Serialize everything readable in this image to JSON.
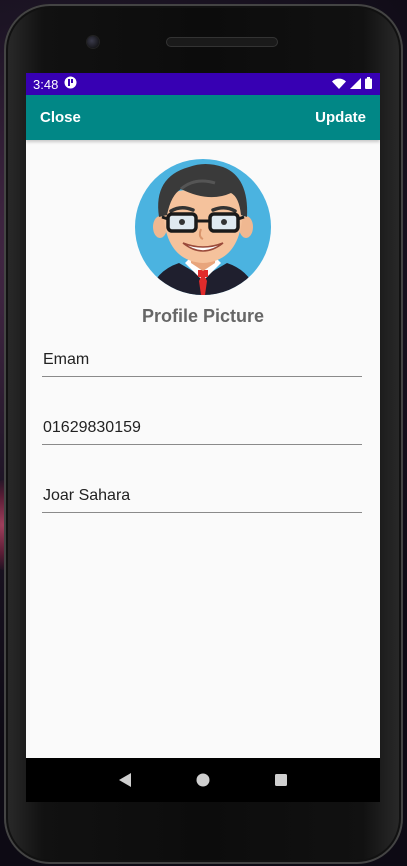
{
  "status_bar": {
    "time": "3:48"
  },
  "app_bar": {
    "close_label": "Close",
    "update_label": "Update"
  },
  "profile": {
    "picture_label": "Profile Picture"
  },
  "form": {
    "name_value": "Emam",
    "phone_value": "01629830159",
    "address_value": "Joar Sahara"
  },
  "colors": {
    "status_bar": "#3700b3",
    "app_bar": "#018786",
    "avatar_bg": "#4bb3e0"
  },
  "icons": {
    "status_app": "app-notification-icon",
    "wifi": "wifi-icon",
    "signal": "signal-icon",
    "battery": "battery-icon",
    "back": "back-icon",
    "home": "home-icon",
    "recents": "recents-icon"
  }
}
